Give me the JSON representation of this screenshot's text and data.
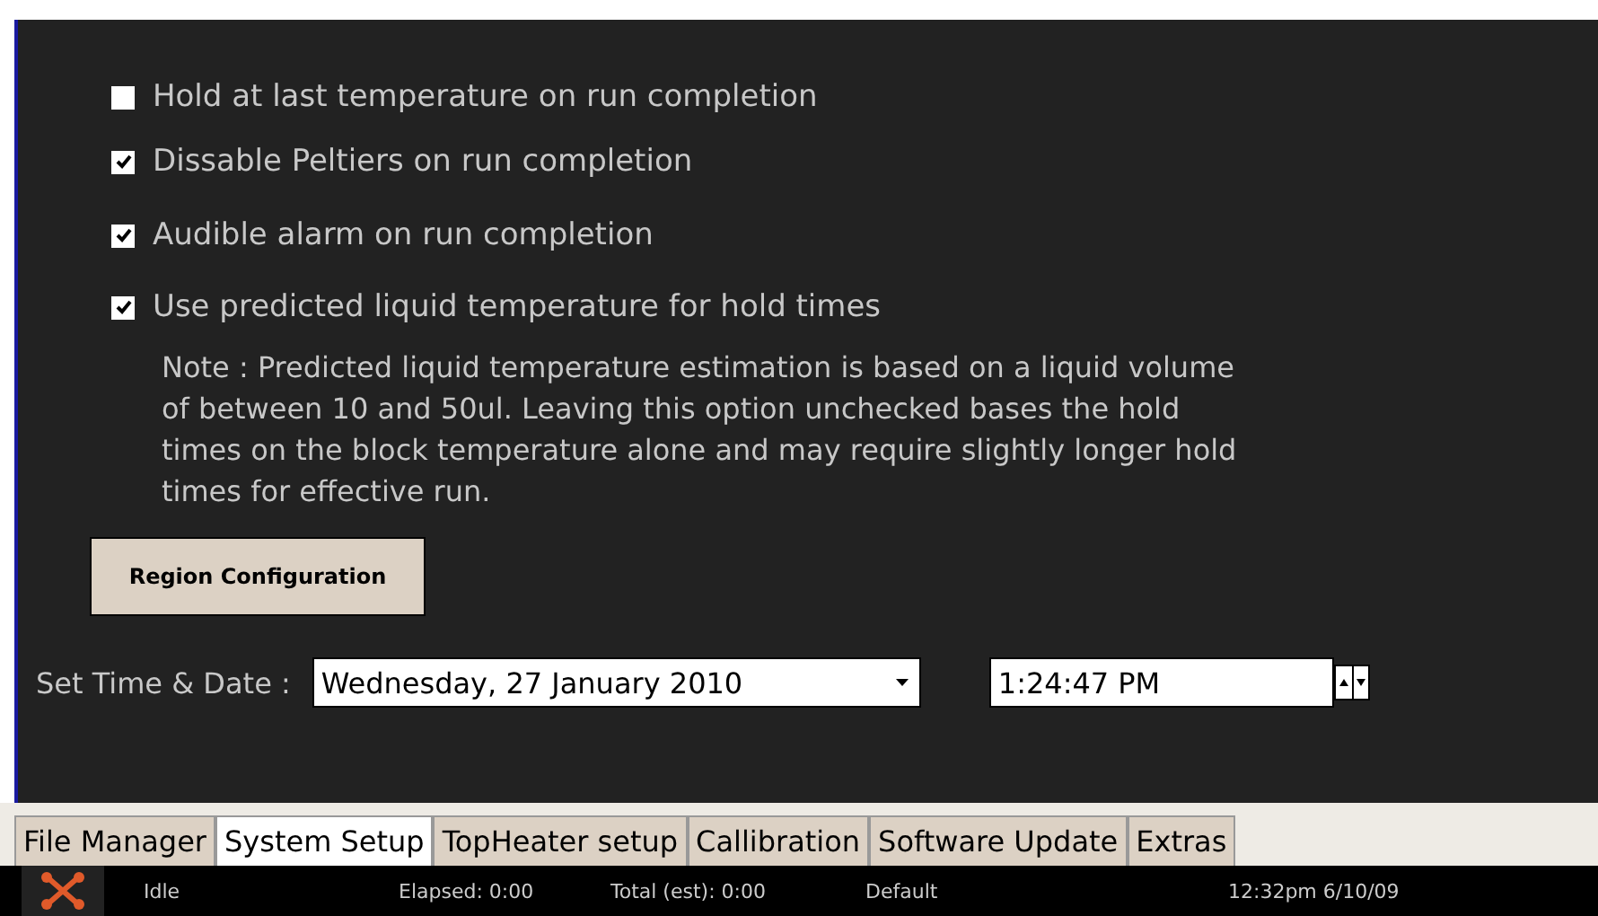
{
  "options": [
    {
      "label": "Hold at last temperature on run completion",
      "checked": false
    },
    {
      "label": "Dissable Peltiers on run completion",
      "checked": true
    },
    {
      "label": "Audible alarm on run completion",
      "checked": true
    },
    {
      "label": "Use predicted liquid temperature for hold times",
      "checked": true
    }
  ],
  "note": "Note : Predicted liquid temperature estimation is based on a liquid volume of between 10 and 50ul. Leaving this option unchecked bases the hold times on the block temperature alone and may require slightly longer hold times for effective run.",
  "region_button": "Region Configuration",
  "time_date": {
    "label": "Set Time & Date :",
    "date": "Wednesday, 27 January 2010",
    "time": "1:24:47 PM"
  },
  "tabs": [
    {
      "label": "File Manager",
      "selected": false
    },
    {
      "label": "System Setup",
      "selected": true
    },
    {
      "label": "TopHeater setup",
      "selected": false
    },
    {
      "label": "Callibration",
      "selected": false
    },
    {
      "label": "Software Update",
      "selected": false
    },
    {
      "label": "Extras",
      "selected": false
    }
  ],
  "status_bar": {
    "state": "Idle",
    "elapsed": "Elapsed: 0:00",
    "total": "Total (est): 0:00",
    "profile": "Default",
    "clock": "12:32pm 6/10/09"
  }
}
